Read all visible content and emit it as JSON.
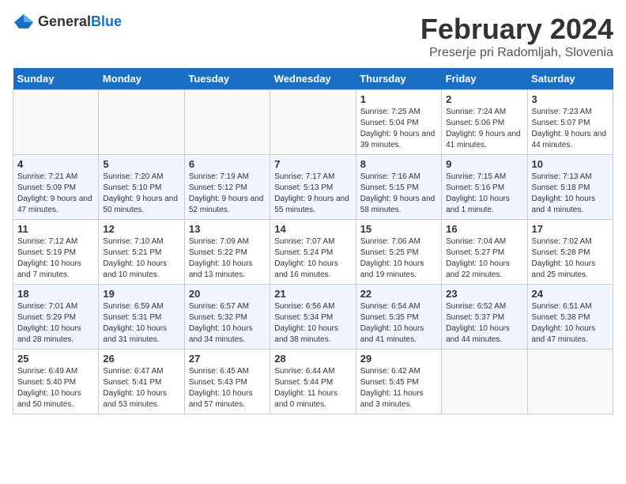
{
  "header": {
    "logo_general": "General",
    "logo_blue": "Blue",
    "month_title": "February 2024",
    "location": "Preserje pri Radomljah, Slovenia"
  },
  "weekdays": [
    "Sunday",
    "Monday",
    "Tuesday",
    "Wednesday",
    "Thursday",
    "Friday",
    "Saturday"
  ],
  "weeks": [
    [
      {
        "day": "",
        "sunrise": "",
        "sunset": "",
        "daylight": "",
        "empty": true
      },
      {
        "day": "",
        "sunrise": "",
        "sunset": "",
        "daylight": "",
        "empty": true
      },
      {
        "day": "",
        "sunrise": "",
        "sunset": "",
        "daylight": "",
        "empty": true
      },
      {
        "day": "",
        "sunrise": "",
        "sunset": "",
        "daylight": "",
        "empty": true
      },
      {
        "day": "1",
        "sunrise": "Sunrise: 7:25 AM",
        "sunset": "Sunset: 5:04 PM",
        "daylight": "Daylight: 9 hours and 39 minutes.",
        "empty": false
      },
      {
        "day": "2",
        "sunrise": "Sunrise: 7:24 AM",
        "sunset": "Sunset: 5:06 PM",
        "daylight": "Daylight: 9 hours and 41 minutes.",
        "empty": false
      },
      {
        "day": "3",
        "sunrise": "Sunrise: 7:23 AM",
        "sunset": "Sunset: 5:07 PM",
        "daylight": "Daylight: 9 hours and 44 minutes.",
        "empty": false
      }
    ],
    [
      {
        "day": "4",
        "sunrise": "Sunrise: 7:21 AM",
        "sunset": "Sunset: 5:09 PM",
        "daylight": "Daylight: 9 hours and 47 minutes.",
        "empty": false
      },
      {
        "day": "5",
        "sunrise": "Sunrise: 7:20 AM",
        "sunset": "Sunset: 5:10 PM",
        "daylight": "Daylight: 9 hours and 50 minutes.",
        "empty": false
      },
      {
        "day": "6",
        "sunrise": "Sunrise: 7:19 AM",
        "sunset": "Sunset: 5:12 PM",
        "daylight": "Daylight: 9 hours and 52 minutes.",
        "empty": false
      },
      {
        "day": "7",
        "sunrise": "Sunrise: 7:17 AM",
        "sunset": "Sunset: 5:13 PM",
        "daylight": "Daylight: 9 hours and 55 minutes.",
        "empty": false
      },
      {
        "day": "8",
        "sunrise": "Sunrise: 7:16 AM",
        "sunset": "Sunset: 5:15 PM",
        "daylight": "Daylight: 9 hours and 58 minutes.",
        "empty": false
      },
      {
        "day": "9",
        "sunrise": "Sunrise: 7:15 AM",
        "sunset": "Sunset: 5:16 PM",
        "daylight": "Daylight: 10 hours and 1 minute.",
        "empty": false
      },
      {
        "day": "10",
        "sunrise": "Sunrise: 7:13 AM",
        "sunset": "Sunset: 5:18 PM",
        "daylight": "Daylight: 10 hours and 4 minutes.",
        "empty": false
      }
    ],
    [
      {
        "day": "11",
        "sunrise": "Sunrise: 7:12 AM",
        "sunset": "Sunset: 5:19 PM",
        "daylight": "Daylight: 10 hours and 7 minutes.",
        "empty": false
      },
      {
        "day": "12",
        "sunrise": "Sunrise: 7:10 AM",
        "sunset": "Sunset: 5:21 PM",
        "daylight": "Daylight: 10 hours and 10 minutes.",
        "empty": false
      },
      {
        "day": "13",
        "sunrise": "Sunrise: 7:09 AM",
        "sunset": "Sunset: 5:22 PM",
        "daylight": "Daylight: 10 hours and 13 minutes.",
        "empty": false
      },
      {
        "day": "14",
        "sunrise": "Sunrise: 7:07 AM",
        "sunset": "Sunset: 5:24 PM",
        "daylight": "Daylight: 10 hours and 16 minutes.",
        "empty": false
      },
      {
        "day": "15",
        "sunrise": "Sunrise: 7:06 AM",
        "sunset": "Sunset: 5:25 PM",
        "daylight": "Daylight: 10 hours and 19 minutes.",
        "empty": false
      },
      {
        "day": "16",
        "sunrise": "Sunrise: 7:04 AM",
        "sunset": "Sunset: 5:27 PM",
        "daylight": "Daylight: 10 hours and 22 minutes.",
        "empty": false
      },
      {
        "day": "17",
        "sunrise": "Sunrise: 7:02 AM",
        "sunset": "Sunset: 5:28 PM",
        "daylight": "Daylight: 10 hours and 25 minutes.",
        "empty": false
      }
    ],
    [
      {
        "day": "18",
        "sunrise": "Sunrise: 7:01 AM",
        "sunset": "Sunset: 5:29 PM",
        "daylight": "Daylight: 10 hours and 28 minutes.",
        "empty": false
      },
      {
        "day": "19",
        "sunrise": "Sunrise: 6:59 AM",
        "sunset": "Sunset: 5:31 PM",
        "daylight": "Daylight: 10 hours and 31 minutes.",
        "empty": false
      },
      {
        "day": "20",
        "sunrise": "Sunrise: 6:57 AM",
        "sunset": "Sunset: 5:32 PM",
        "daylight": "Daylight: 10 hours and 34 minutes.",
        "empty": false
      },
      {
        "day": "21",
        "sunrise": "Sunrise: 6:56 AM",
        "sunset": "Sunset: 5:34 PM",
        "daylight": "Daylight: 10 hours and 38 minutes.",
        "empty": false
      },
      {
        "day": "22",
        "sunrise": "Sunrise: 6:54 AM",
        "sunset": "Sunset: 5:35 PM",
        "daylight": "Daylight: 10 hours and 41 minutes.",
        "empty": false
      },
      {
        "day": "23",
        "sunrise": "Sunrise: 6:52 AM",
        "sunset": "Sunset: 5:37 PM",
        "daylight": "Daylight: 10 hours and 44 minutes.",
        "empty": false
      },
      {
        "day": "24",
        "sunrise": "Sunrise: 6:51 AM",
        "sunset": "Sunset: 5:38 PM",
        "daylight": "Daylight: 10 hours and 47 minutes.",
        "empty": false
      }
    ],
    [
      {
        "day": "25",
        "sunrise": "Sunrise: 6:49 AM",
        "sunset": "Sunset: 5:40 PM",
        "daylight": "Daylight: 10 hours and 50 minutes.",
        "empty": false
      },
      {
        "day": "26",
        "sunrise": "Sunrise: 6:47 AM",
        "sunset": "Sunset: 5:41 PM",
        "daylight": "Daylight: 10 hours and 53 minutes.",
        "empty": false
      },
      {
        "day": "27",
        "sunrise": "Sunrise: 6:45 AM",
        "sunset": "Sunset: 5:43 PM",
        "daylight": "Daylight: 10 hours and 57 minutes.",
        "empty": false
      },
      {
        "day": "28",
        "sunrise": "Sunrise: 6:44 AM",
        "sunset": "Sunset: 5:44 PM",
        "daylight": "Daylight: 11 hours and 0 minutes.",
        "empty": false
      },
      {
        "day": "29",
        "sunrise": "Sunrise: 6:42 AM",
        "sunset": "Sunset: 5:45 PM",
        "daylight": "Daylight: 11 hours and 3 minutes.",
        "empty": false
      },
      {
        "day": "",
        "sunrise": "",
        "sunset": "",
        "daylight": "",
        "empty": true
      },
      {
        "day": "",
        "sunrise": "",
        "sunset": "",
        "daylight": "",
        "empty": true
      }
    ]
  ]
}
